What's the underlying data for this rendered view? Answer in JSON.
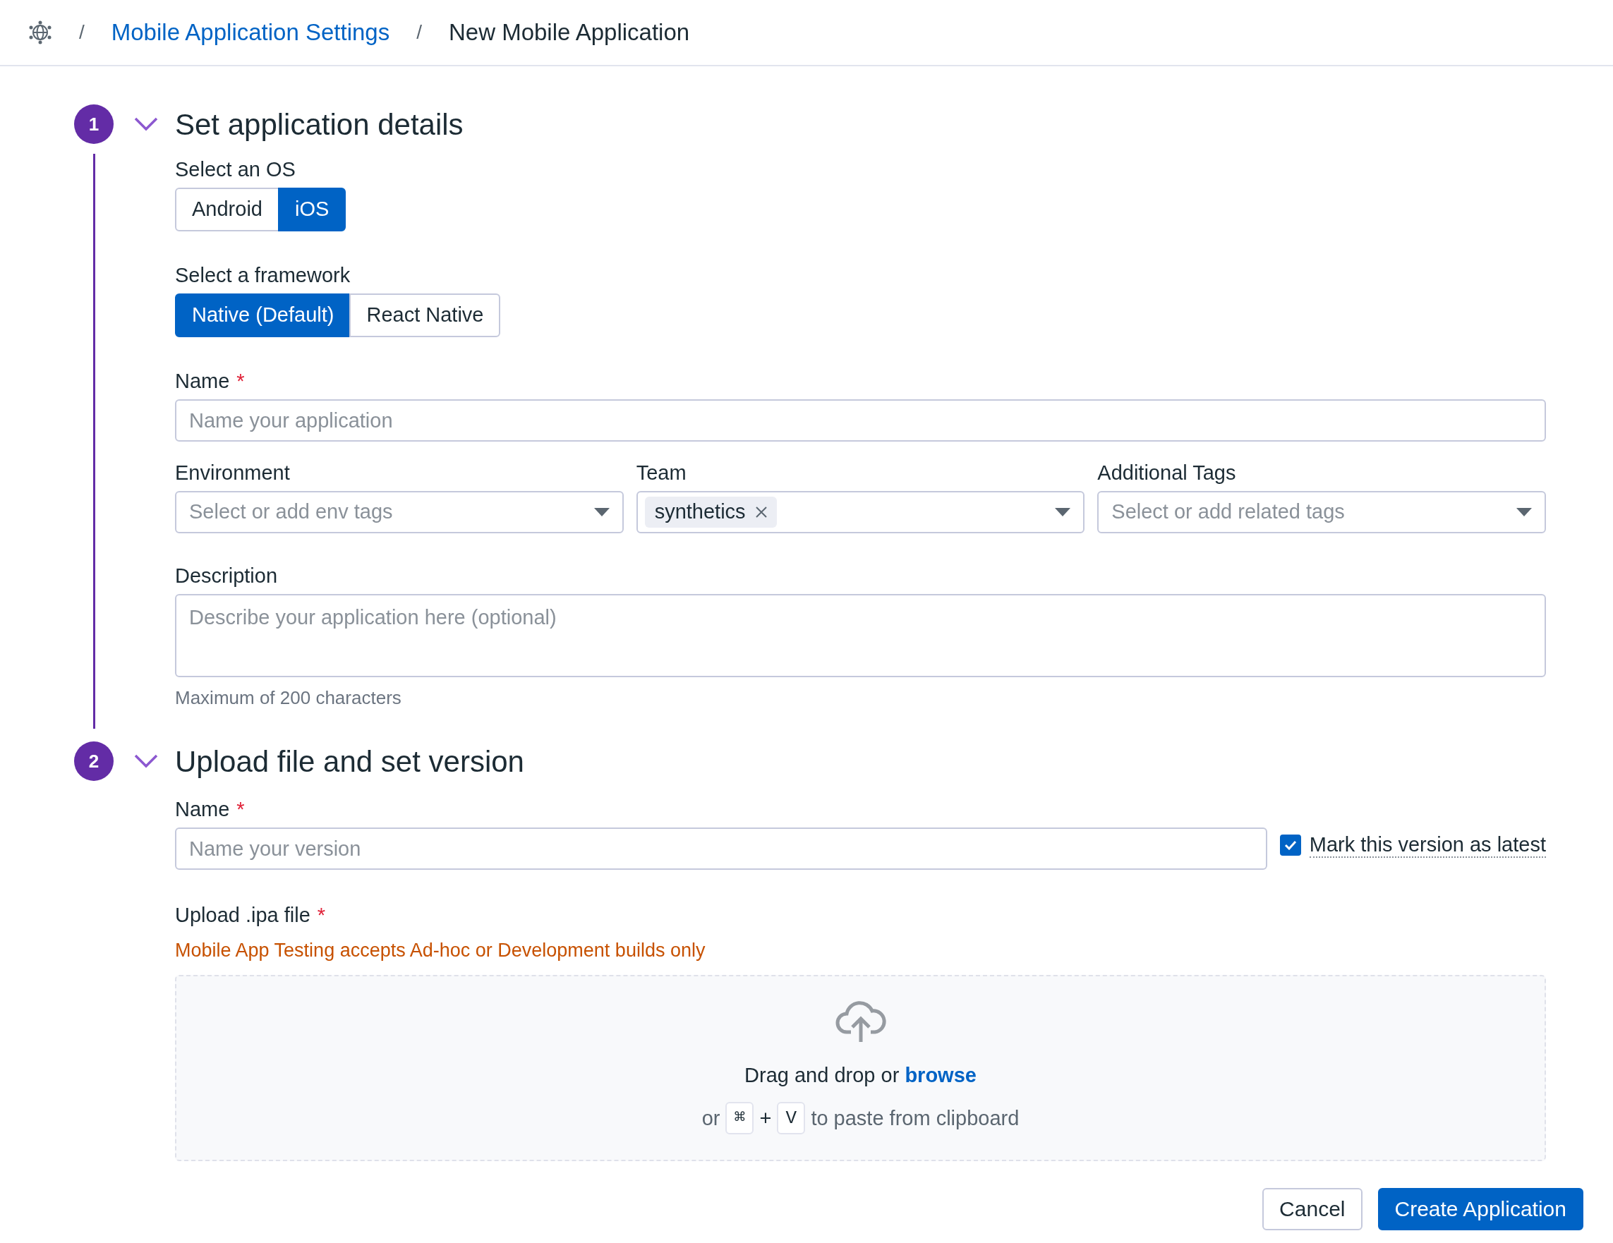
{
  "breadcrumb": {
    "items": [
      {
        "separator": "/",
        "label": "Mobile Application Settings",
        "kind": "link"
      },
      {
        "separator": "/",
        "label": "New Mobile Application",
        "kind": "current"
      }
    ]
  },
  "steps": [
    {
      "number": "1",
      "title": "Set application details",
      "expanded": true
    },
    {
      "number": "2",
      "title": "Upload file and set version",
      "expanded": true
    }
  ],
  "os": {
    "label": "Select an OS",
    "options": [
      {
        "label": "Android",
        "selected": false
      },
      {
        "label": "iOS",
        "selected": true
      }
    ]
  },
  "framework": {
    "label": "Select a framework",
    "options": [
      {
        "label": "Native (Default)",
        "selected": true
      },
      {
        "label": "React Native",
        "selected": false
      }
    ]
  },
  "app_name": {
    "label": "Name",
    "required_mark": "*",
    "placeholder": "Name your application"
  },
  "environment": {
    "label": "Environment",
    "placeholder": "Select or add env tags"
  },
  "team": {
    "label": "Team",
    "tags": [
      "synthetics"
    ]
  },
  "additional_tags": {
    "label": "Additional Tags",
    "placeholder": "Select or add related tags"
  },
  "description": {
    "label": "Description",
    "placeholder": "Describe your application here (optional)",
    "hint": "Maximum of 200 characters"
  },
  "version_name": {
    "label": "Name",
    "required_mark": "*",
    "placeholder": "Name your version"
  },
  "mark_latest": {
    "label": "Mark this version as latest",
    "checked": true
  },
  "upload": {
    "label": "Upload .ipa file",
    "required_mark": "*",
    "warning": "Mobile App Testing accepts Ad-hoc or Development builds only",
    "prompt": "Drag and drop or",
    "link": "browse",
    "paste_prefix": "or",
    "keys": [
      "⌘",
      "V"
    ],
    "joiner": "+",
    "paste_suffix": "to paste from clipboard"
  },
  "buttons": [
    {
      "label": "Cancel",
      "kind": "secondary"
    },
    {
      "label": "Create Application",
      "kind": "primary"
    }
  ]
}
